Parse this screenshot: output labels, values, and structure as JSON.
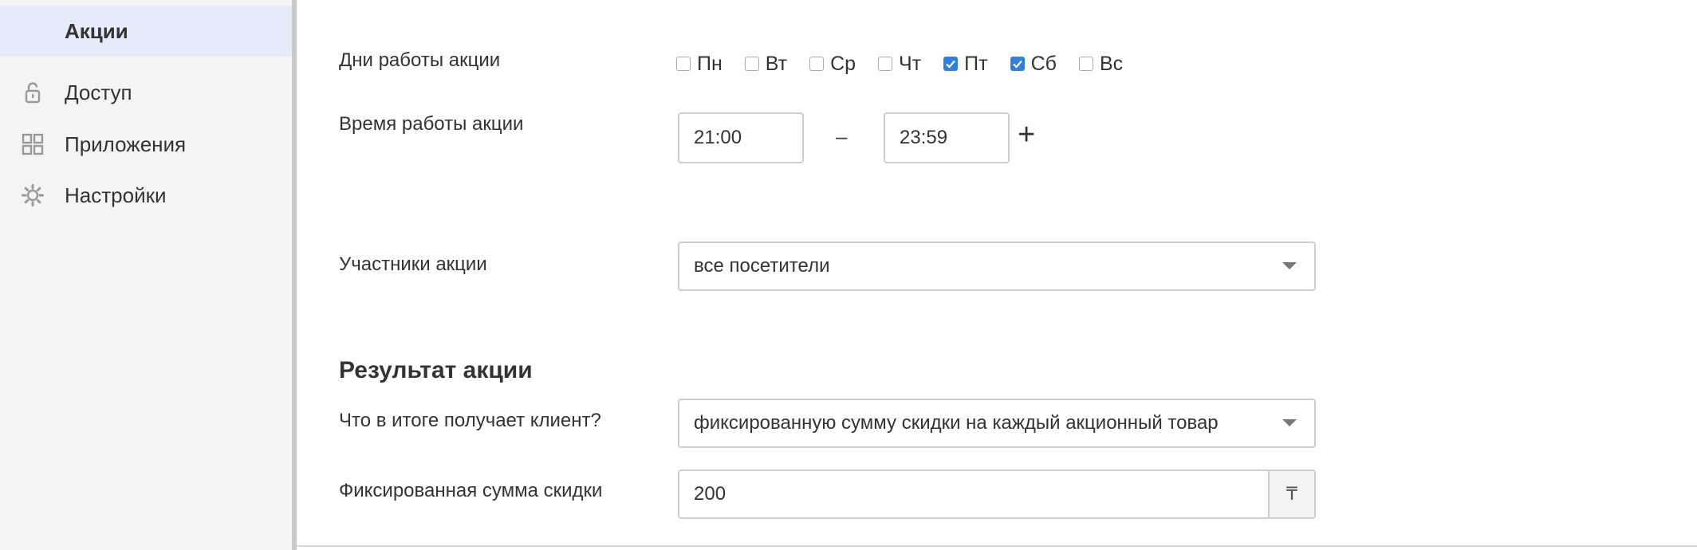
{
  "sidebar": {
    "items": [
      {
        "label": "Акции",
        "icon": "none",
        "active": true
      },
      {
        "label": "Доступ",
        "icon": "lock-icon"
      },
      {
        "label": "Приложения",
        "icon": "grid-icon"
      },
      {
        "label": "Настройки",
        "icon": "gear-icon"
      }
    ]
  },
  "form": {
    "days_label": "Дни работы акции",
    "days": [
      {
        "label": "Пн",
        "checked": false
      },
      {
        "label": "Вт",
        "checked": false
      },
      {
        "label": "Ср",
        "checked": false
      },
      {
        "label": "Чт",
        "checked": false
      },
      {
        "label": "Пт",
        "checked": true
      },
      {
        "label": "Сб",
        "checked": true
      },
      {
        "label": "Вс",
        "checked": false
      }
    ],
    "time_label": "Время работы акции",
    "time_from": "21:00",
    "time_separator": "–",
    "time_to": "23:59",
    "add_time": "+",
    "participants_label": "Участники акции",
    "participants_value": "все посетители",
    "result_title": "Результат акции",
    "client_gets_label": "Что в итоге получает клиент?",
    "client_gets_value": "фиксированную сумму скидки на каждый акционный товар",
    "fixed_discount_label": "Фиксированная сумма скидки",
    "fixed_discount_value": "200",
    "currency": "₸"
  },
  "colors": {
    "accent": "#2f7fe0",
    "active_bg": "#e3ecf8",
    "sidebar_bg": "#f4f4f4"
  }
}
